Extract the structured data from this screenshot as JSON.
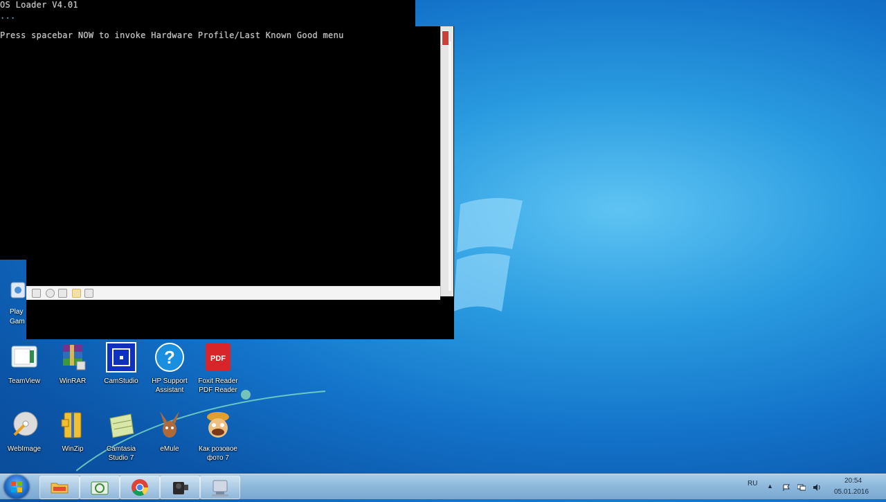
{
  "console": {
    "title_line": "OS Loader V4.01",
    "dots_line": "...",
    "prompt_line": "Press spacebar NOW to invoke Hardware Profile/Last Known Good menu"
  },
  "partial_icon": {
    "label_line1": "Play",
    "label_line2": "Gam"
  },
  "desktop_icons": [
    {
      "label": "TeamView",
      "icon": "teamviewer-icon"
    },
    {
      "label": "WinRAR",
      "icon": "winrar-icon"
    },
    {
      "label": "CamStudio",
      "icon": "camstudio-icon"
    },
    {
      "label": "HP Support Assistant",
      "icon": "hp-support-assistant-icon"
    },
    {
      "label": "Foxit Reader PDF Reader",
      "icon": "pdf-reader-icon"
    },
    {
      "label": "WebImage",
      "icon": "disc-image-icon"
    },
    {
      "label": "WinZip",
      "icon": "winzip-icon"
    },
    {
      "label": "Camtasia Studio 7",
      "icon": "camtasia-icon"
    },
    {
      "label": "eMule",
      "icon": "emule-icon"
    },
    {
      "label": "Как розовое фото 7",
      "icon": "cartoon-face-icon"
    }
  ],
  "taskbar": {
    "apps": [
      {
        "name": "explorer",
        "icon": "folder-icon"
      },
      {
        "name": "hp-recovery",
        "icon": "hp-recovery-icon"
      },
      {
        "name": "chrome",
        "icon": "chrome-icon"
      },
      {
        "name": "camcorder",
        "icon": "camcorder-icon"
      },
      {
        "name": "virtual-machine",
        "icon": "virtual-machine-icon"
      }
    ],
    "language": "RU",
    "time": "20:54",
    "date": "05.01.2016"
  },
  "colors": {
    "desktop_blue": "#1373c9",
    "taskbar": "#8fb9dc",
    "console_bg": "#000000",
    "console_text": "#c8c8c8"
  }
}
